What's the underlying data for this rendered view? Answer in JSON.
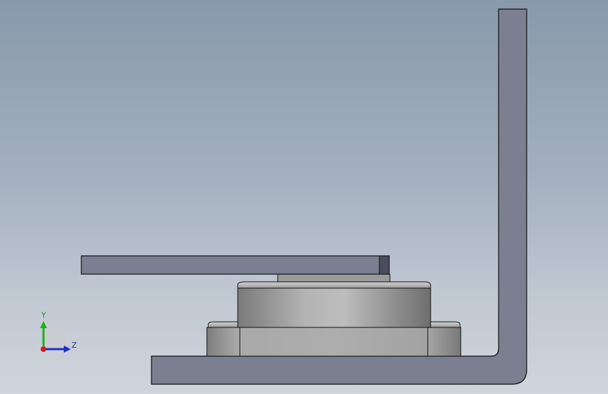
{
  "triad": {
    "y_label": "Y",
    "z_label": "Z",
    "colors": {
      "y_axis": "#19b219",
      "z_axis": "#1c2fc4",
      "x_axis": "#d41c1c"
    }
  },
  "colors": {
    "background_top": "#8799ab",
    "background_bottom": "#cfd5dc",
    "bracket_fill": "#7b7f8f",
    "plate_fill": "#7b7f92",
    "part_fill": "#a6a6a6",
    "edge": "#111111"
  }
}
